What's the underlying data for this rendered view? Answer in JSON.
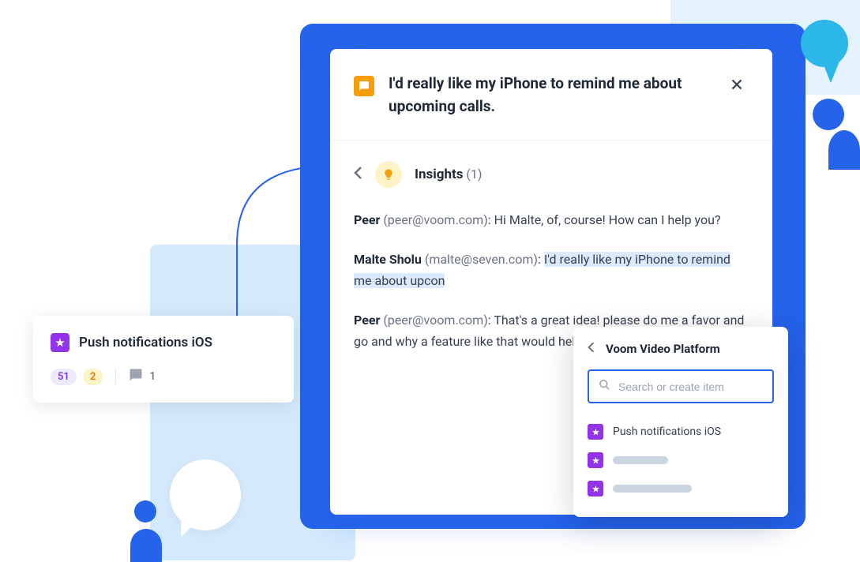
{
  "feature_card": {
    "title": "Push notifications iOS",
    "stat_1": "51",
    "stat_2": "2",
    "comments": "1"
  },
  "modal": {
    "title": "I'd really like my iPhone to remind me about upcoming calls.",
    "insights_label": "Insights",
    "insights_count": "(1)",
    "messages": [
      {
        "author": "Peer",
        "email": "(peer@voom.com)",
        "text": "Hi Malte, of, course! How can I help you?"
      },
      {
        "author": "Malte Sholu",
        "email": "(malte@seven.com)",
        "text_before": "",
        "highlighted": "I'd really like my iPhone to remind me about upcon",
        "text_after": ""
      },
      {
        "author": "Peer",
        "email": "(peer@voom.com)",
        "text": "That's a great idea! please do me a favor and go and why a feature like that would help"
      }
    ]
  },
  "dropdown": {
    "title": "Voom Video Platform",
    "search_placeholder": "Search or create item",
    "items": [
      {
        "label": "Push notifications iOS"
      },
      {
        "label": ""
      },
      {
        "label": ""
      }
    ],
    "placeholder_widths": [
      "70px",
      "100px"
    ]
  }
}
